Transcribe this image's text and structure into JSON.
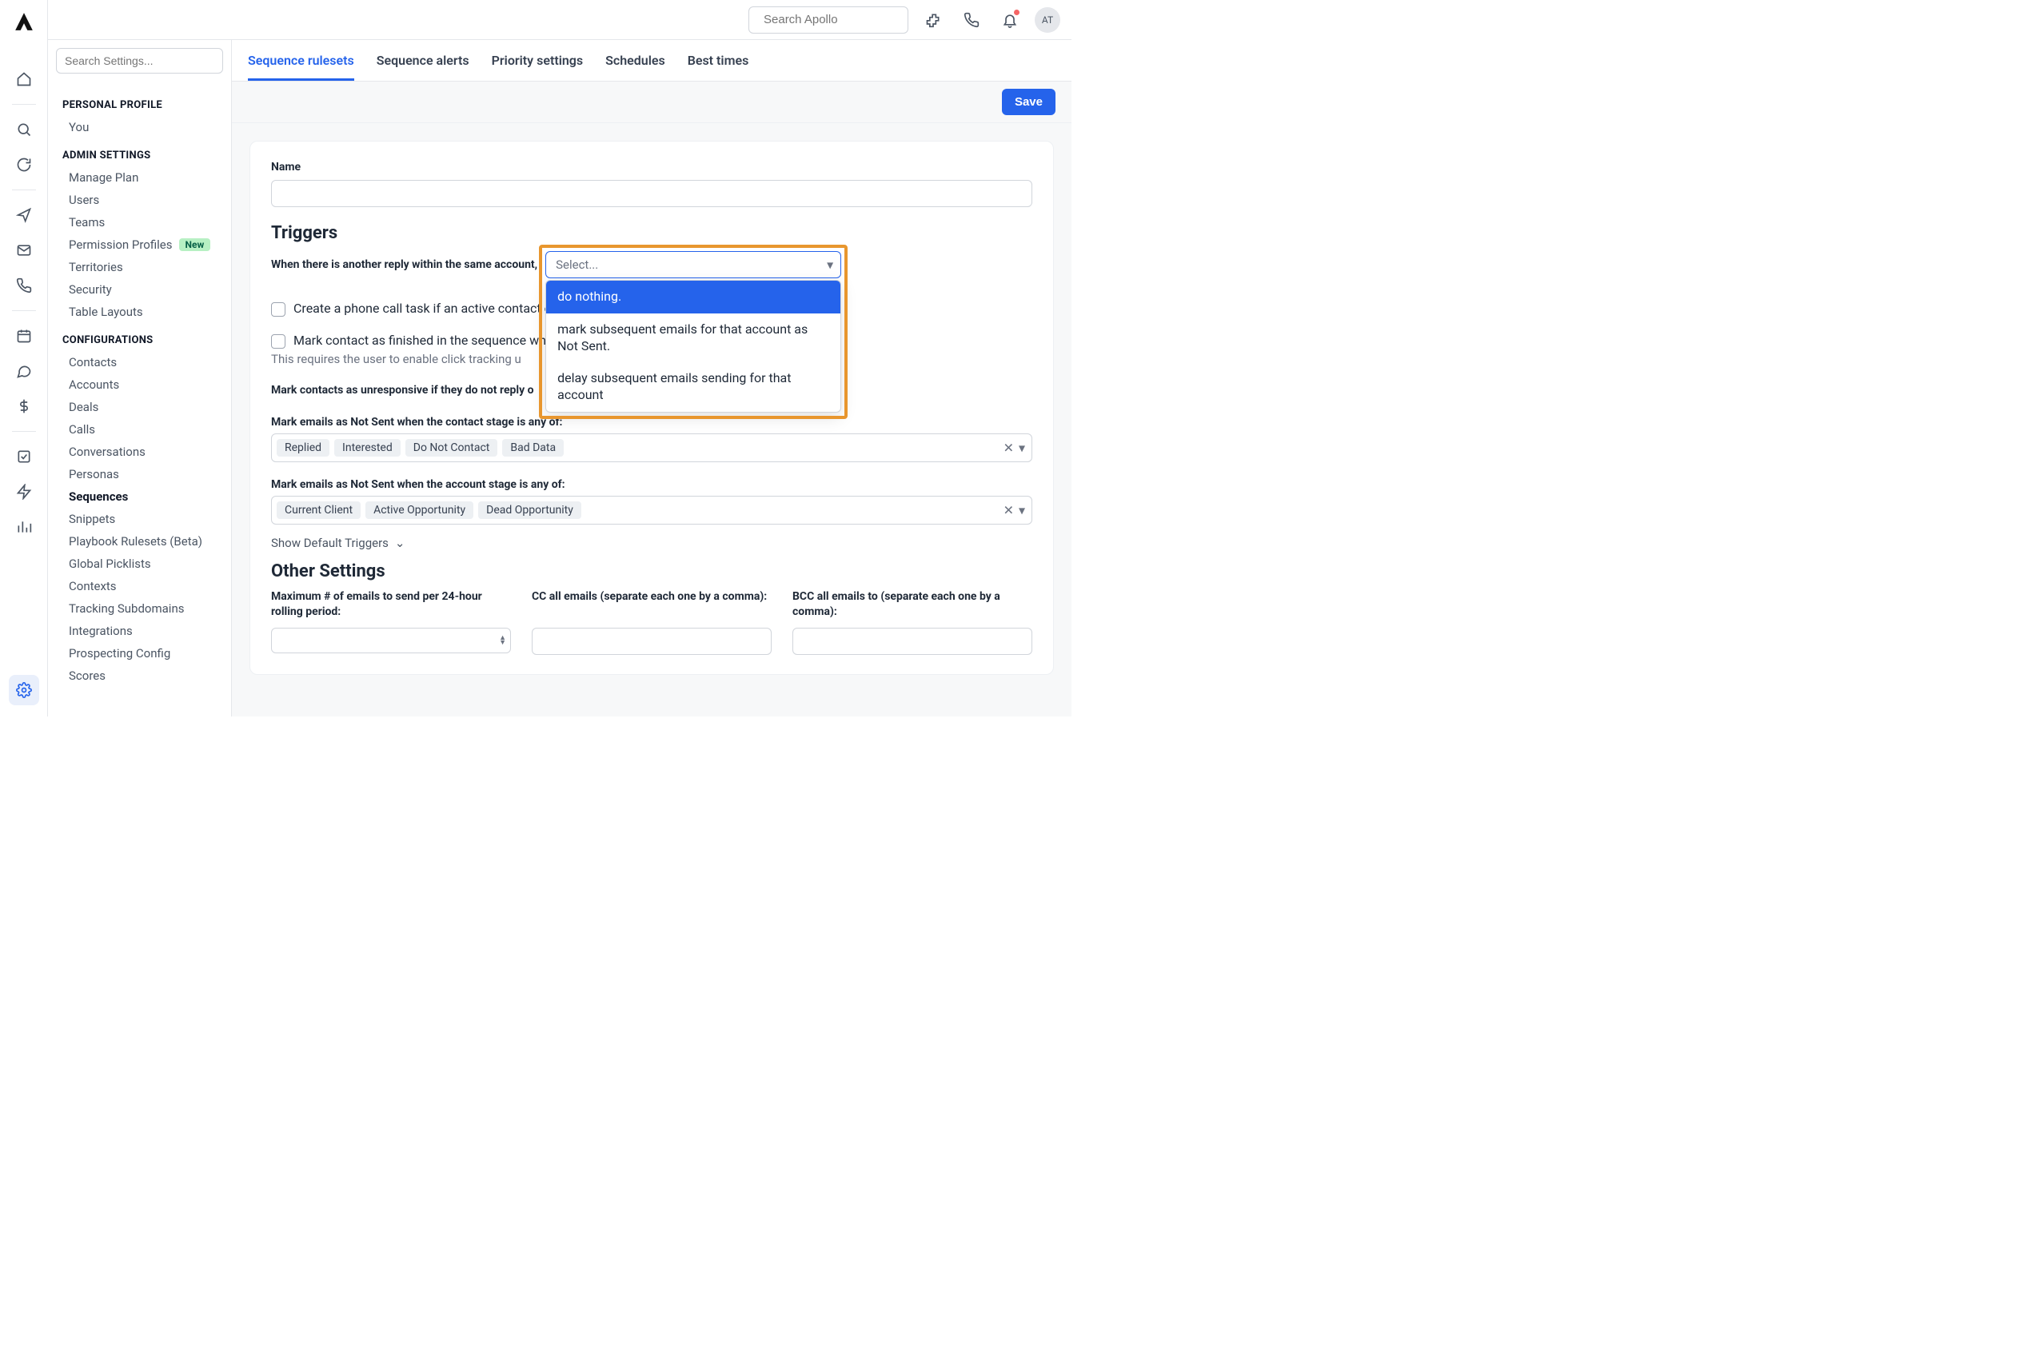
{
  "topbar": {
    "search_placeholder": "Search Apollo",
    "avatar_initials": "AT"
  },
  "settings_sidebar": {
    "search_placeholder": "Search Settings...",
    "sections": {
      "personal": {
        "title": "PERSONAL PROFILE",
        "items": [
          "You"
        ]
      },
      "admin": {
        "title": "ADMIN SETTINGS",
        "items": [
          "Manage Plan",
          "Users",
          "Teams",
          "Permission Profiles",
          "Territories",
          "Security",
          "Table Layouts"
        ],
        "new_badge_on": "Permission Profiles",
        "new_badge_text": "New"
      },
      "config": {
        "title": "CONFIGURATIONS",
        "items": [
          "Contacts",
          "Accounts",
          "Deals",
          "Calls",
          "Conversations",
          "Personas",
          "Sequences",
          "Snippets",
          "Playbook Rulesets (Beta)",
          "Global Picklists",
          "Contexts",
          "Tracking Subdomains",
          "Integrations",
          "Prospecting Config",
          "Scores"
        ],
        "active": "Sequences"
      }
    }
  },
  "tabs": {
    "items": [
      "Sequence rulesets",
      "Sequence alerts",
      "Priority settings",
      "Schedules",
      "Best times"
    ],
    "active": "Sequence rulesets"
  },
  "actions": {
    "save": "Save"
  },
  "form": {
    "name_label": "Name",
    "triggers_heading": "Triggers",
    "reply_prompt": "When there is another reply within the same account,",
    "reply_select": {
      "placeholder": "Select...",
      "options": [
        "do nothing.",
        "mark subsequent emails for that account as Not Sent.",
        "delay subsequent emails sending for that account"
      ],
      "highlighted": "do nothing."
    },
    "cb_phone": "Create a phone call task if an active contact o",
    "cb_mark_finished": "Mark contact as finished in the sequence wh",
    "cb_mark_finished_sub": "This requires the user to enable click tracking u",
    "unresponsive_prompt": "Mark contacts as unresponsive if they do not reply o",
    "notsent_contact_prompt": "Mark emails as Not Sent when the contact stage is any of:",
    "notsent_contact_tokens": [
      "Replied",
      "Interested",
      "Do Not Contact",
      "Bad Data"
    ],
    "notsent_account_prompt": "Mark emails as Not Sent when the account stage is any of:",
    "notsent_account_tokens": [
      "Current Client",
      "Active Opportunity",
      "Dead Opportunity"
    ],
    "show_default": "Show Default Triggers",
    "other_heading": "Other Settings",
    "max_emails_label": "Maximum # of emails to send per 24-hour rolling period:",
    "cc_label": "CC all emails (separate each one by a comma):",
    "bcc_label": "BCC all emails to (separate each one by a comma):"
  }
}
